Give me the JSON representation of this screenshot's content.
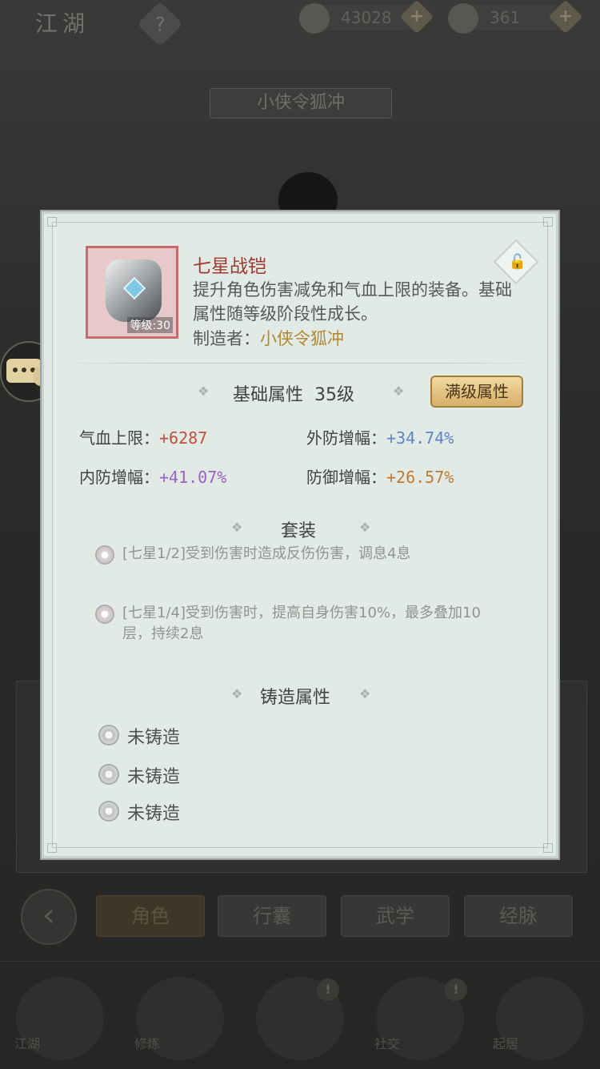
{
  "topbar": {
    "title": "江湖",
    "help": "?",
    "currency_copper": "43028",
    "currency_silver": "361"
  },
  "character_name": "小侠令狐冲",
  "tabs": [
    {
      "label": "角色",
      "active": true
    },
    {
      "label": "行囊",
      "active": false
    },
    {
      "label": "武学",
      "active": false
    },
    {
      "label": "经脉",
      "active": false
    }
  ],
  "bottom_nav": [
    "江湖",
    "修炼",
    "",
    "社交",
    "起居"
  ],
  "item": {
    "name": "七星战铠",
    "level_label": "等级:30",
    "description": "提升角色伤害减免和气血上限的装备。基础属性随等级阶段性成长。",
    "maker_label": "制造者：",
    "maker_name": "小侠令狐冲"
  },
  "base_attr": {
    "title": "基础属性",
    "level": "35级",
    "max_button": "满级属性",
    "stats": [
      {
        "label": "气血上限：",
        "value": "+6287",
        "color": "#c0503b"
      },
      {
        "label": "外防增幅：",
        "value": "+34.74%",
        "color": "#5a86c7"
      },
      {
        "label": "内防增幅：",
        "value": "+41.07%",
        "color": "#9b61c4"
      },
      {
        "label": "防御增幅：",
        "value": "+26.57%",
        "color": "#c07a34"
      }
    ]
  },
  "set": {
    "title": "套装",
    "effects": [
      "[七星1/2]受到伤害时造成反伤伤害，调息4息",
      "[七星1/4]受到伤害时，提高自身伤害10%，最多叠加10层，持续2息"
    ]
  },
  "forge": {
    "title": "铸造属性",
    "slots": [
      "未铸造",
      "未铸造",
      "未铸造"
    ]
  }
}
